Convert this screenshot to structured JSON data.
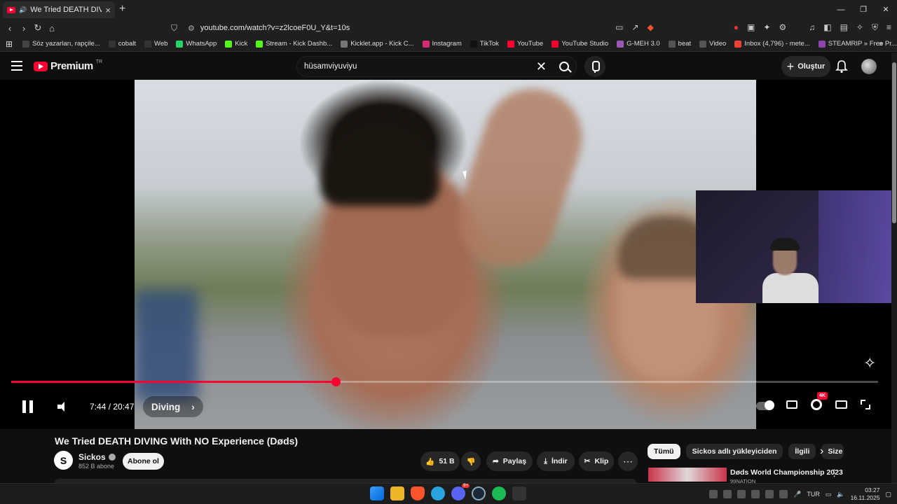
{
  "browser": {
    "tab_title": "We Tried DEATH DIVING With",
    "new_tab": "+",
    "url": "youtube.com/watch?v=z2lcoeF0U_Y&t=10s",
    "window_controls": [
      "—",
      "❐",
      "✕"
    ]
  },
  "bookmarks": [
    {
      "label": "Söz yazarları, rapçile...",
      "color": "#444"
    },
    {
      "label": "cobalt",
      "color": "#333"
    },
    {
      "label": "Web",
      "color": "#333"
    },
    {
      "label": "WhatsApp",
      "color": "#25d366"
    },
    {
      "label": "Kick",
      "color": "#53fc18"
    },
    {
      "label": "Stream - Kick Dashb...",
      "color": "#53fc18"
    },
    {
      "label": "Kicklet.app - Kick C...",
      "color": "#777"
    },
    {
      "label": "Instagram",
      "color": "#d62976"
    },
    {
      "label": "TikTok",
      "color": "#111"
    },
    {
      "label": "YouTube",
      "color": "#ff0033"
    },
    {
      "label": "YouTube Studio",
      "color": "#ff0033"
    },
    {
      "label": "G-MEH 3.0",
      "color": "#9b59b6"
    },
    {
      "label": "beat",
      "color": "#555"
    },
    {
      "label": "Video",
      "color": "#555"
    },
    {
      "label": "Inbox (4,796) - mete...",
      "color": "#ea4335"
    },
    {
      "label": "STEAMRIP » Free Pr...",
      "color": "#8e44ad"
    }
  ],
  "youtube": {
    "logo_text": "Premium",
    "logo_region": "TR",
    "search_value": "hüsamviyuviyu",
    "create_label": "Oluştur"
  },
  "player": {
    "time": "7:44 / 20:47",
    "chapter": "Diving",
    "played_fraction": 0.374,
    "badge_4k": "4K"
  },
  "video": {
    "title": "We Tried DEATH DIVING With NO Experience (Døds)",
    "channel": "Sickos",
    "subscribers": "852 B abone",
    "subscribe_label": "Abone ol",
    "likes": "51 B",
    "share_label": "Paylaş",
    "download_label": "İndir",
    "clip_label": "Klip"
  },
  "chips": [
    "Tümü",
    "Sickos adlı yükleyiciden",
    "İlgili",
    "Size"
  ],
  "recommendation": {
    "title": "Døds World Championship 2023",
    "channel": "99NATION"
  },
  "taskbar": {
    "lang": "TUR",
    "time": "03:27",
    "date": "16.11.2025",
    "discord_badge": "9+"
  }
}
